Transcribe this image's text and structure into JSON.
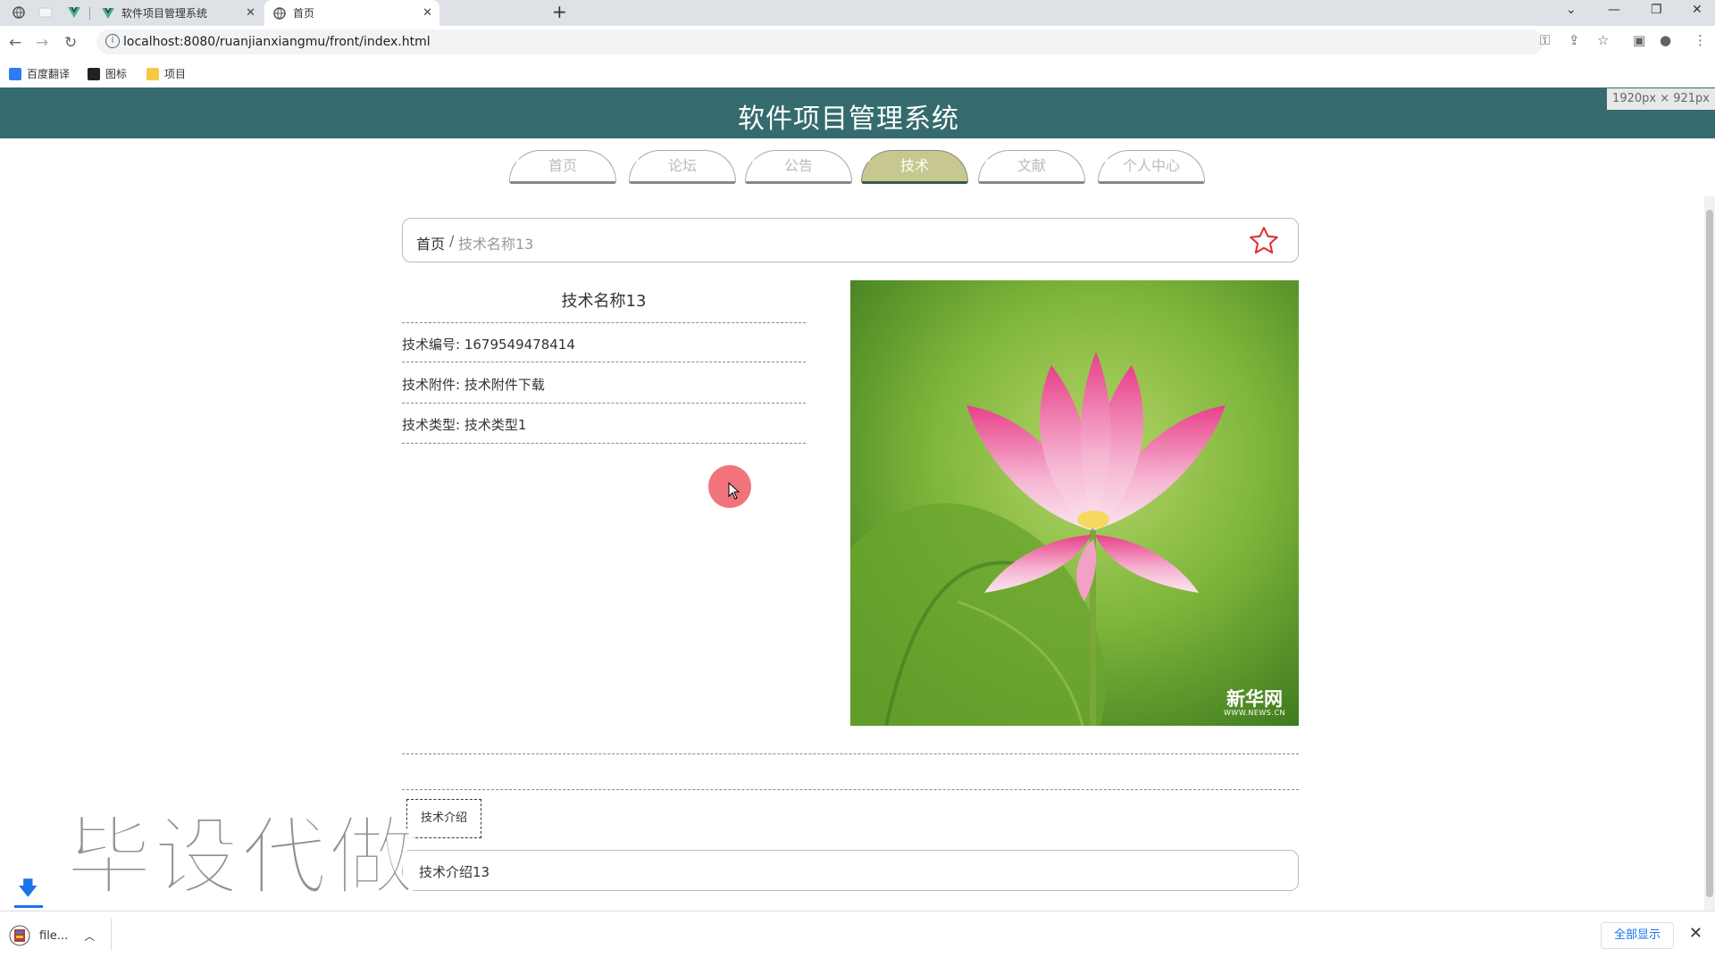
{
  "browser": {
    "tabs": [
      {
        "title": "软件项目管理系统",
        "close": "✕"
      },
      {
        "title": "首页",
        "close": "✕"
      }
    ],
    "new_tab": "+",
    "url": "localhost:8080/ruanjianxiangmu/front/index.html",
    "bookmarks": [
      "百度翻译",
      "图标",
      "项目"
    ]
  },
  "site": {
    "title": "软件项目管理系统",
    "size_badge": "1920px × 921px"
  },
  "nav": [
    "首页",
    "论坛",
    "公告",
    "技术",
    "文献",
    "个人中心"
  ],
  "nav_active_index": 3,
  "breadcrumb": {
    "home": "首页",
    "sep": "/",
    "current": "技术名称13"
  },
  "detail": {
    "title": "技术名称13",
    "fields": [
      "技术编号: 1679549478414",
      "技术附件: 技术附件下载",
      "技术类型: 技术类型1"
    ],
    "image_watermark": {
      "big": "新华网",
      "small": "WWW.NEWS.CN"
    }
  },
  "intro": {
    "tab_label": "技术介绍",
    "content": "技术介绍13"
  },
  "overlay_watermark": "毕设代做",
  "downloads": {
    "file": "file...",
    "show_all": "全部显示"
  }
}
